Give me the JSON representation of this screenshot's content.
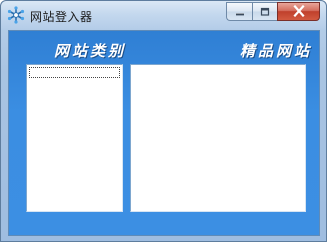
{
  "window": {
    "title": "网站登入器",
    "controls": {
      "minimize_icon": "minimize-icon",
      "maximize_icon": "maximize-icon",
      "close_icon": "close-icon"
    }
  },
  "header": {
    "left_label": "网站类别",
    "right_label": "精品网站"
  },
  "category_list": {
    "items": []
  },
  "sites_panel": {
    "items": []
  },
  "colors": {
    "client_blue": "#3b8ee2",
    "frame": "#b9d1ea",
    "close_red": "#c0402c"
  }
}
